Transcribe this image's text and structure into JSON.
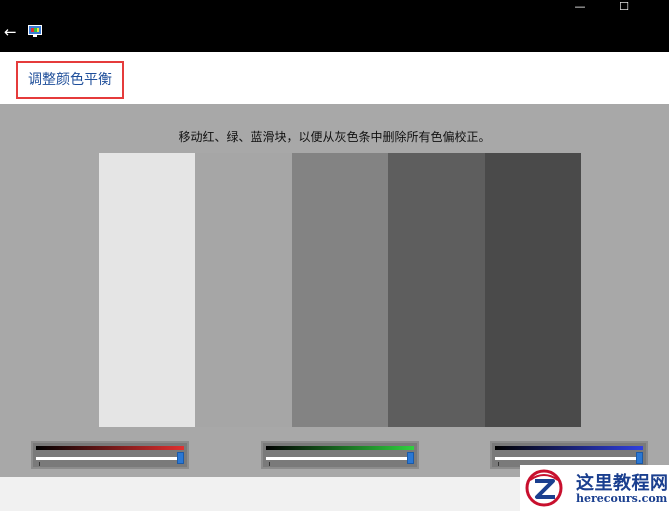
{
  "window": {
    "back_icon": "←",
    "app_icon": "display-color-calibration-icon",
    "minimize_symbol": "—",
    "maximize_symbol": "☐"
  },
  "page": {
    "title": "调整颜色平衡",
    "instruction": "移动红、绿、蓝滑块，以便从灰色条中删除所有色偏校正。"
  },
  "gray_bars": [
    "#e5e5e5",
    "#a6a6a6",
    "#838383",
    "#5e5e5e",
    "#4a4a4a"
  ],
  "sliders": [
    {
      "name": "red",
      "gradient_end": "#e03030",
      "value_percent": 100
    },
    {
      "name": "green",
      "gradient_end": "#30d040",
      "value_percent": 100
    },
    {
      "name": "blue",
      "gradient_end": "#3040e0",
      "value_percent": 100
    }
  ],
  "watermark": {
    "name": "这里教程网",
    "url": "herecours.com"
  }
}
